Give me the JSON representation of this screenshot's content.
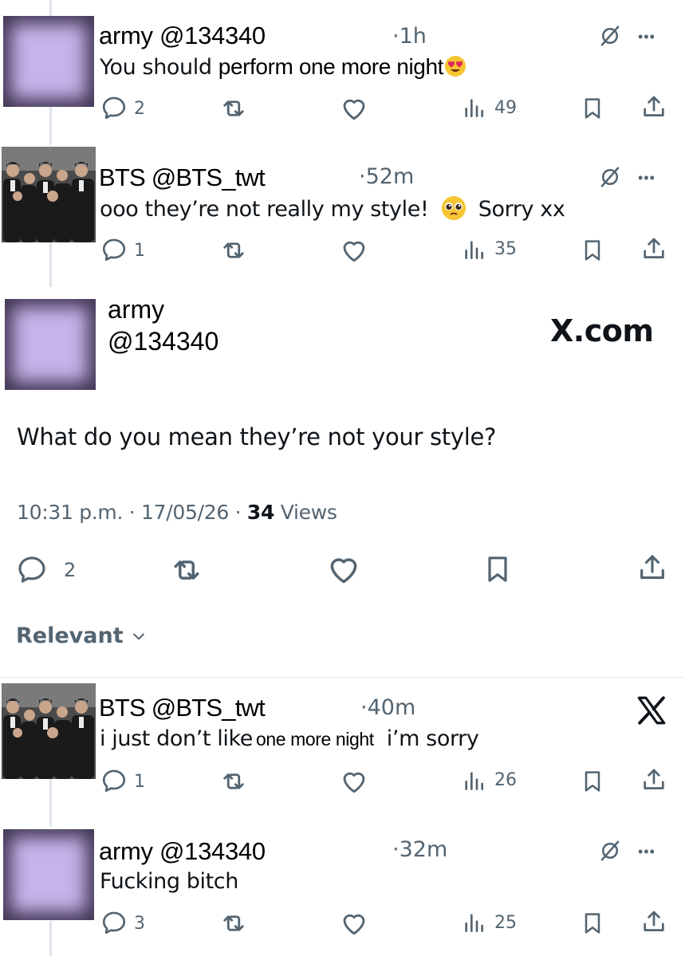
{
  "tweets": [
    {
      "name": "army @134340",
      "time": "·1h",
      "text": "You should",
      "text_alt": "perform one more night",
      "emoji": "heart-eyes",
      "replies": "2",
      "views": "49"
    },
    {
      "name": "BTS @BTS_twt",
      "time": "·52m",
      "text": "ooo they’re not really my style!",
      "text_after": "Sorry xx",
      "emoji": "pleading-face",
      "replies": "1",
      "views": "35"
    },
    {
      "name": "BTS @BTS_twt",
      "time": "·40m",
      "text": "i just don’t like",
      "text_alt": "one more night",
      "text_after": "i’m sorry",
      "replies": "1",
      "views": "26"
    },
    {
      "name": "army @134340",
      "time": "·32m",
      "text": "Fucking bitch",
      "replies": "3",
      "views": "25"
    }
  ],
  "detail": {
    "name_line1": "army",
    "name_line2": "@134340",
    "brand": "X.com",
    "text": "What do you mean they’re not your style?",
    "time": "10:31 p.m. · 17/05/26 · ",
    "views_count": "34",
    "views_label": " Views",
    "replies": "2"
  },
  "sort_label": "Relevant",
  "colors": {
    "avatar_purple": "#c6b3ea",
    "secondary_text": "#536471",
    "thread_line": "#dfe3ea"
  },
  "icons": [
    "reply-icon",
    "retweet-icon",
    "like-icon",
    "views-icon",
    "bookmark-icon",
    "share-icon",
    "grok-icon",
    "more-icon",
    "x-logo-icon"
  ]
}
